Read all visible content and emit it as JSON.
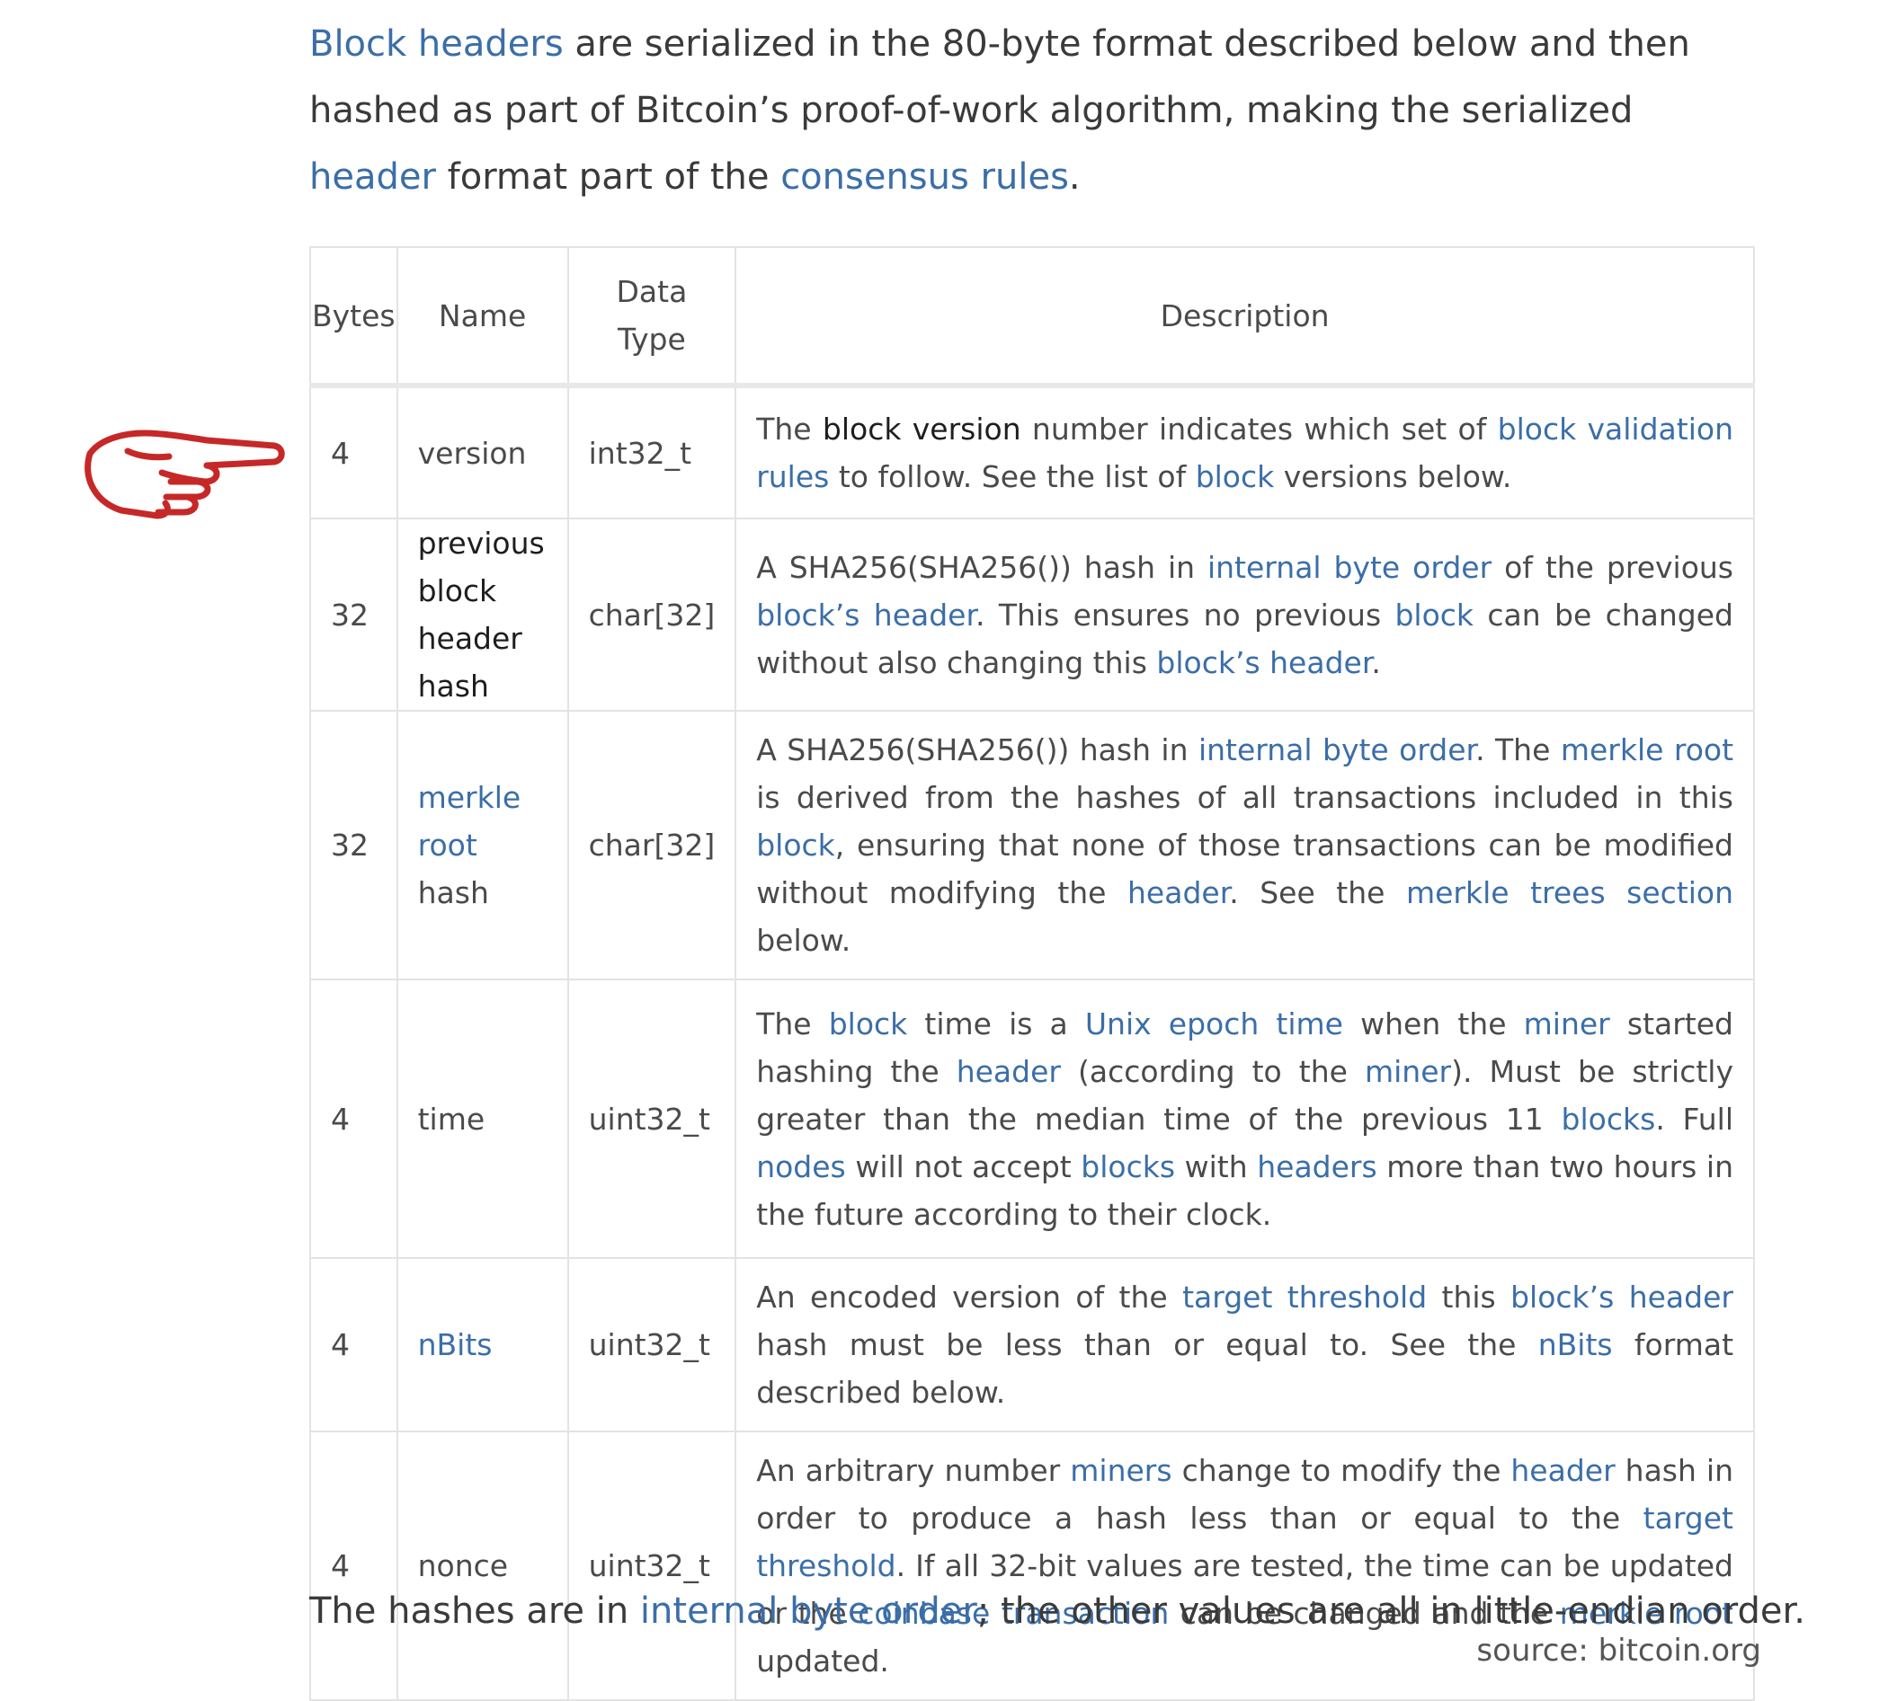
{
  "intro": {
    "l1": "Block headers",
    "t1": " are serialized in the 80-byte format described below and then hashed as part of Bitcoin’s proof-of-work algorithm, making the serialized ",
    "l2": "header",
    "t2": " format part of the ",
    "l3": "consensus rules",
    "t3": "."
  },
  "table": {
    "headers": {
      "bytes": "Bytes",
      "name": "Name",
      "type_line1": "Data",
      "type_line2": "Type",
      "description": "Description"
    },
    "rows": [
      {
        "bytes": "4",
        "name": "version",
        "type": "int32_t",
        "desc": [
          {
            "t": "The "
          },
          {
            "t": "block version",
            "k": "dark"
          },
          {
            "t": " number indicates which set of "
          },
          {
            "t": "block validation rules",
            "k": "link"
          },
          {
            "t": " to follow. See the list of "
          },
          {
            "t": "block",
            "k": "link"
          },
          {
            "t": " versions below."
          }
        ]
      },
      {
        "bytes": "32",
        "name": "previous block header hash",
        "type": "char[32]",
        "desc": [
          {
            "t": "A SHA256(SHA256()) hash in "
          },
          {
            "t": "internal byte order",
            "k": "link"
          },
          {
            "t": " of the previous "
          },
          {
            "t": "block’s header",
            "k": "link"
          },
          {
            "t": ". This ensures no previous "
          },
          {
            "t": "block",
            "k": "link"
          },
          {
            "t": " can be changed without also changing this "
          },
          {
            "t": "block’s header",
            "k": "link"
          },
          {
            "t": "."
          }
        ]
      },
      {
        "bytes": "32",
        "name_link": "merkle root",
        "name_tail": "hash",
        "type": "char[32]",
        "desc": [
          {
            "t": "A SHA256(SHA256()) hash in "
          },
          {
            "t": "internal byte order",
            "k": "link"
          },
          {
            "t": ". The "
          },
          {
            "t": "merkle root",
            "k": "link"
          },
          {
            "t": " is derived from the hashes of all transactions included in this "
          },
          {
            "t": "block",
            "k": "link"
          },
          {
            "t": ", ensuring that none of those transactions can be modified without modifying the "
          },
          {
            "t": "header",
            "k": "link"
          },
          {
            "t": ". See the "
          },
          {
            "t": "merkle trees section",
            "k": "link"
          },
          {
            "t": " below."
          }
        ]
      },
      {
        "bytes": "4",
        "name": "time",
        "type": "uint32_t",
        "desc": [
          {
            "t": "The "
          },
          {
            "t": "block",
            "k": "link"
          },
          {
            "t": " time is a "
          },
          {
            "t": "Unix epoch time",
            "k": "link"
          },
          {
            "t": " when the "
          },
          {
            "t": "miner",
            "k": "link"
          },
          {
            "t": " started hashing the "
          },
          {
            "t": "header",
            "k": "link"
          },
          {
            "t": " (according to the "
          },
          {
            "t": "miner",
            "k": "link"
          },
          {
            "t": "). Must be strictly greater than the median time of the previous 11 "
          },
          {
            "t": "blocks",
            "k": "link"
          },
          {
            "t": ". Full "
          },
          {
            "t": "nodes",
            "k": "link"
          },
          {
            "t": " will not accept "
          },
          {
            "t": "blocks",
            "k": "link"
          },
          {
            "t": " with "
          },
          {
            "t": "headers",
            "k": "link"
          },
          {
            "t": " more than two hours in the future according to their clock."
          }
        ]
      },
      {
        "bytes": "4",
        "name_link": "nBits",
        "type": "uint32_t",
        "desc": [
          {
            "t": "An encoded version of the "
          },
          {
            "t": "target threshold",
            "k": "link"
          },
          {
            "t": " this "
          },
          {
            "t": "block’s header",
            "k": "link"
          },
          {
            "t": " hash must be less than or equal to. See the "
          },
          {
            "t": "nBits",
            "k": "link"
          },
          {
            "t": " format described below."
          }
        ]
      },
      {
        "bytes": "4",
        "name": "nonce",
        "type": "uint32_t",
        "desc": [
          {
            "t": "An arbitrary number "
          },
          {
            "t": "miners",
            "k": "link"
          },
          {
            "t": " change to modify the "
          },
          {
            "t": "header",
            "k": "link"
          },
          {
            "t": " hash in order to produce a hash less than or equal to the "
          },
          {
            "t": "target threshold",
            "k": "link"
          },
          {
            "t": ". If all 32-bit values are tested, the time can be updated or the "
          },
          {
            "t": "coinbase transaction",
            "k": "link"
          },
          {
            "t": " can be changed and the "
          },
          {
            "t": "merkle root",
            "k": "link"
          },
          {
            "t": " updated."
          }
        ]
      }
    ]
  },
  "footer": {
    "t1": "The hashes are in ",
    "link": "internal byte order",
    "t2": "; the other values are all in little-endian order."
  },
  "source": "source: bitcoin.org",
  "pointer": {
    "icon": "pointing-hand-icon",
    "color": "#c62828"
  }
}
